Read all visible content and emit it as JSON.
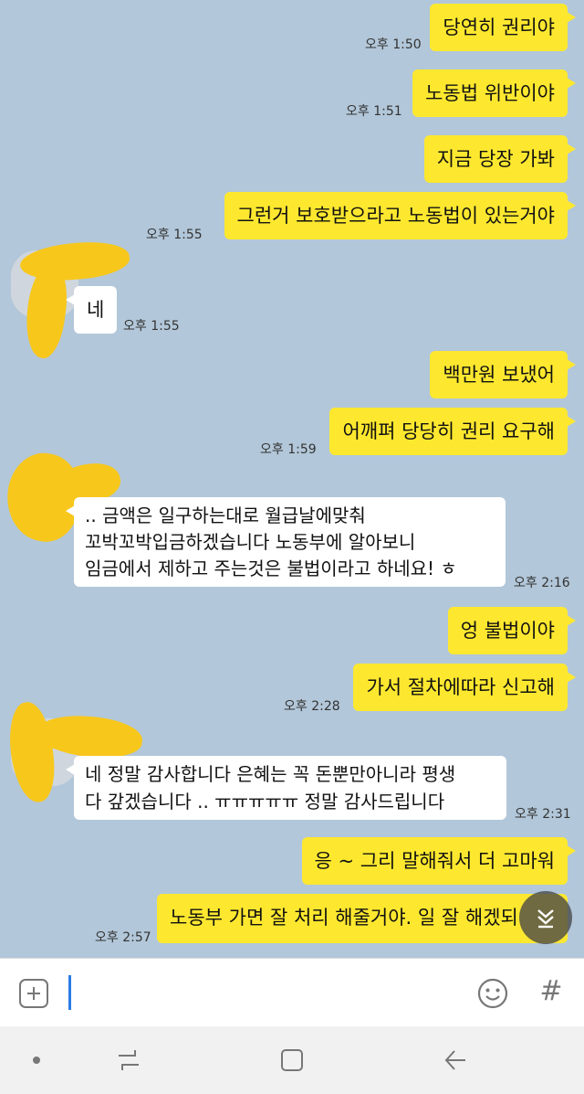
{
  "messages": [
    {
      "text": "당연히 권리야",
      "time": "오후 1:50"
    },
    {
      "text": "노동법 위반이야",
      "time": "오후 1:51"
    },
    {
      "text": "지금 당장 가봐",
      "time": ""
    },
    {
      "text": "그런거 보호받으라고 노동법이 있는거야",
      "time": "오후 1:55"
    },
    {
      "text": "네",
      "time": "오후 1:55"
    },
    {
      "text": "백만원 보냈어",
      "time": ""
    },
    {
      "text": "어깨펴 당당히 권리 요구해",
      "time": "오후 1:59"
    },
    {
      "text": ".. 금액은 일구하는대로 월급날에맞춰\n꼬박꼬박입금하겠습니다 노동부에 알아보니\n임금에서 제하고 주는것은 불법이라고 하네요! ㅎ",
      "time": "오후 2:16"
    },
    {
      "text": "엉 불법이야",
      "time": ""
    },
    {
      "text": "가서 절차에따라 신고해",
      "time": "오후 2:28"
    },
    {
      "text": "네 정말 감사합니다 은혜는 꼭 돈뿐만아니라 평생\n다 갚겠습니다 .. ㅠㅠㅠㅠㅠ 정말 감사드립니다",
      "time": "오후 2:31"
    },
    {
      "text": "응 ~  그리 말해줘서 더 고마워",
      "time": ""
    },
    {
      "text": "노동부 가면 잘 처리 해줄거야. 일 잘 해겠되",
      "time": "오후 2:57"
    }
  ],
  "icons": {
    "attach": "plus-icon",
    "emoji": "emoji-icon",
    "hash": "hash-icon",
    "scroll": "double-chevron-down-icon",
    "nav": [
      "dot-icon",
      "recent-apps-icon",
      "home-icon",
      "back-icon"
    ]
  },
  "input": {
    "value": "",
    "hash_label": "#"
  },
  "colors": {
    "chat_background": "#b2c7d9",
    "sent_bubble": "#fee82f",
    "received_bubble": "#ffffff",
    "caret": "#2c7be5"
  }
}
